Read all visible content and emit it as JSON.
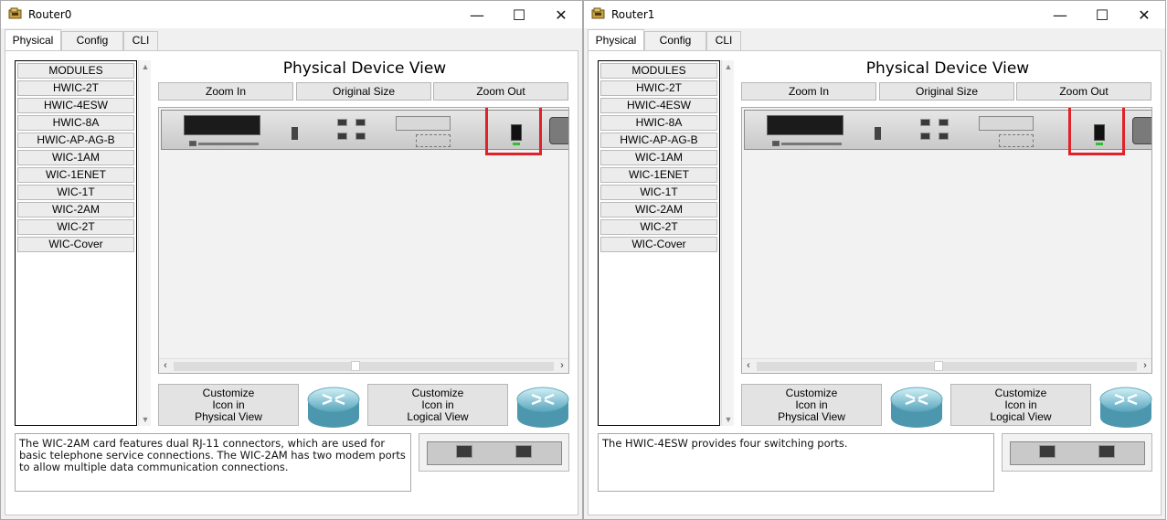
{
  "windows": [
    {
      "title": "Router0",
      "tabs": [
        "Physical",
        "Config",
        "CLI"
      ],
      "modules_header": "MODULES",
      "modules": [
        "HWIC-2T",
        "HWIC-4ESW",
        "HWIC-8A",
        "HWIC-AP-AG-B",
        "WIC-1AM",
        "WIC-1ENET",
        "WIC-1T",
        "WIC-2AM",
        "WIC-2T",
        "WIC-Cover"
      ],
      "view_title": "Physical Device View",
      "zoom_in": "Zoom In",
      "original_size": "Original Size",
      "zoom_out": "Zoom Out",
      "customize_physical": [
        "Customize",
        "Icon in",
        "Physical View"
      ],
      "customize_logical": [
        "Customize",
        "Icon in",
        "Logical View"
      ],
      "description": "The WIC-2AM card features dual RJ-11 connectors, which are used for basic telephone service connections. The WIC-2AM has two modem ports to allow multiple data communication connections.",
      "module_image_type": "wic-2am-card-image"
    },
    {
      "title": "Router1",
      "tabs": [
        "Physical",
        "Config",
        "CLI"
      ],
      "modules_header": "MODULES",
      "modules": [
        "HWIC-2T",
        "HWIC-4ESW",
        "HWIC-8A",
        "HWIC-AP-AG-B",
        "WIC-1AM",
        "WIC-1ENET",
        "WIC-1T",
        "WIC-2AM",
        "WIC-2T",
        "WIC-Cover"
      ],
      "view_title": "Physical Device View",
      "zoom_in": "Zoom In",
      "original_size": "Original Size",
      "zoom_out": "Zoom Out",
      "customize_physical": [
        "Customize",
        "Icon in",
        "Physical View"
      ],
      "customize_logical": [
        "Customize",
        "Icon in",
        "Logical View"
      ],
      "description": "The HWIC-4ESW provides four switching ports.",
      "module_image_type": "hwic-4esw-card-image"
    }
  ],
  "window_controls": {
    "minimize": "—",
    "maximize": "☐",
    "close": "✕"
  },
  "colors": {
    "highlight": "#e0222a",
    "power_led": "#2fbf2f"
  }
}
